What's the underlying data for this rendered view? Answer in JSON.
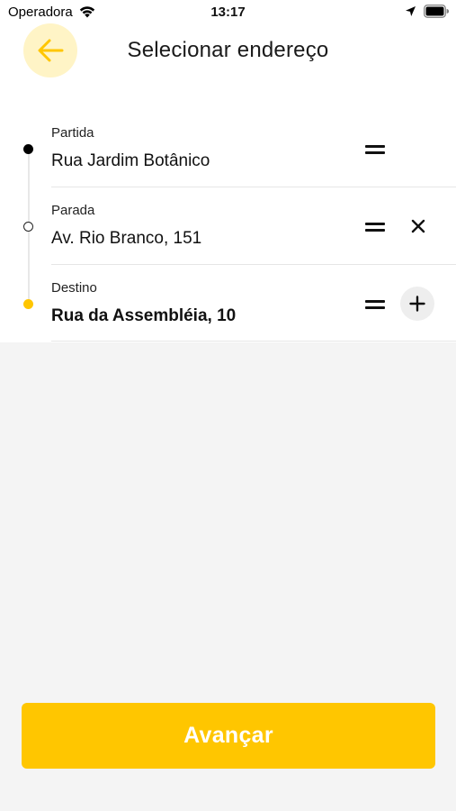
{
  "status_bar": {
    "carrier": "Operadora",
    "time": "13:17",
    "icons": [
      "wifi-icon",
      "location-icon",
      "battery-icon"
    ]
  },
  "header": {
    "back_icon": "arrow-left-icon",
    "title": "Selecionar endereço"
  },
  "addresses": [
    {
      "label": "Partida",
      "value": "Rua Jardim Botânico",
      "marker": "filled-black-dot",
      "actions": [
        "drag-handle"
      ]
    },
    {
      "label": "Parada",
      "value": "Av. Rio Branco, 151",
      "marker": "hollow-dot",
      "actions": [
        "drag-handle",
        "remove-stop"
      ]
    },
    {
      "label": "Destino",
      "value": "Rua da Assembléia, 10",
      "marker": "yellow-dot",
      "actions": [
        "drag-handle",
        "add-stop"
      ]
    }
  ],
  "footer": {
    "primary_button": "Avançar"
  },
  "colors": {
    "accent": "#ffc600",
    "accent_light": "#fff4c6",
    "background": "#f4f4f4",
    "surface": "#ffffff",
    "text": "#111111"
  }
}
